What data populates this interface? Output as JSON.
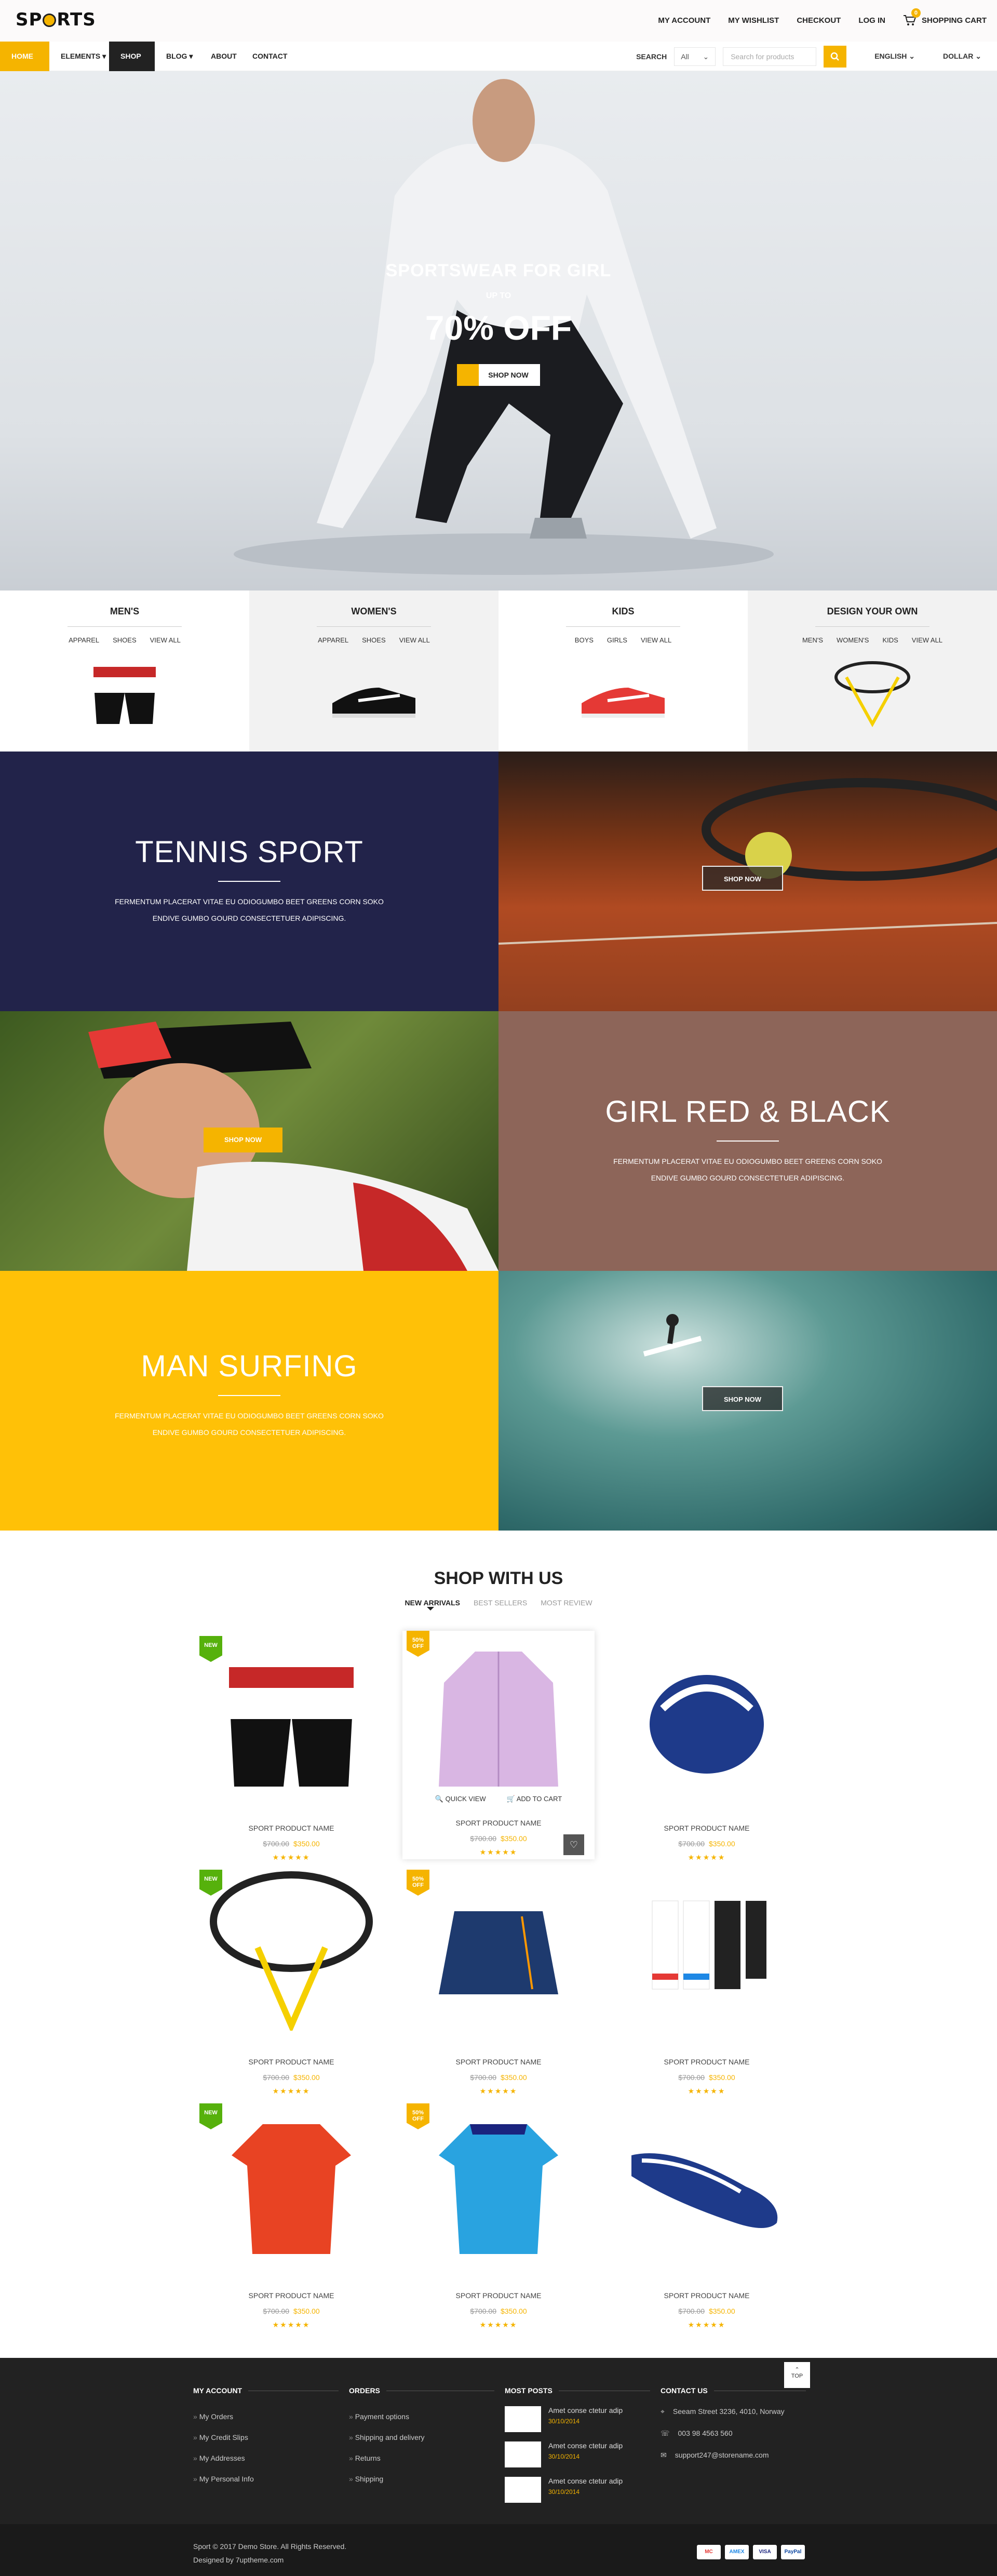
{
  "header": {
    "logo": "SPORTS",
    "links": [
      "MY ACCOUNT",
      "MY WISHLIST",
      "CHECKOUT",
      "LOG IN"
    ],
    "cart_count": "0",
    "cart_label": "SHOPPING CART"
  },
  "nav": {
    "items": [
      "HOME",
      "ELEMENTS",
      "SHOP",
      "BLOG",
      "ABOUT",
      "CONTACT"
    ],
    "search_label": "SEARCH",
    "category_value": "All",
    "search_placeholder": "Search for products",
    "language": "ENGLISH",
    "currency": "DOLLAR"
  },
  "hero": {
    "title": "SPORTSWEAR FOR GIRL",
    "upto": "UP TO",
    "offer": "70% OFF",
    "button": "SHOP NOW"
  },
  "categories": [
    {
      "title": "MEN'S",
      "subs": [
        "APPAREL",
        "SHOES",
        "VIEW ALL"
      ]
    },
    {
      "title": "WOMEN'S",
      "subs": [
        "APPAREL",
        "SHOES",
        "VIEW ALL"
      ]
    },
    {
      "title": "KIDS",
      "subs": [
        "BOYS",
        "GIRLS",
        "VIEW ALL"
      ]
    },
    {
      "title": "DESIGN YOUR OWN",
      "subs": [
        "MEN'S",
        "WOMEN'S",
        "KIDS",
        "VIEW ALL"
      ]
    }
  ],
  "banners": {
    "tennis": {
      "title": "TENNIS SPORT",
      "text": "FERMENTUM PLACERAT VITAE EU ODIOGUMBO BEET GREENS CORN SOKO ENDIVE GUMBO GOURD CONSECTETUER ADIPISCING.",
      "button": "SHOP NOW"
    },
    "girl": {
      "title": "GIRL RED & BLACK",
      "text": "FERMENTUM PLACERAT VITAE EU ODIOGUMBO BEET GREENS CORN SOKO ENDIVE GUMBO GOURD CONSECTETUER ADIPISCING.",
      "button": "SHOP NOW"
    },
    "surf": {
      "title": "MAN SURFING",
      "text": "FERMENTUM PLACERAT VITAE EU ODIOGUMBO BEET GREENS CORN SOKO ENDIVE GUMBO GOURD CONSECTETUER ADIPISCING.",
      "button": "SHOP NOW"
    }
  },
  "shop": {
    "title": "SHOP WITH US",
    "tabs": [
      "NEW ARRIVALS",
      "BEST SELLERS",
      "MOST REVIEW"
    ],
    "quick_view": "QUICK VIEW",
    "add_to_cart": "ADD TO CART",
    "products": [
      {
        "tag": "NEW",
        "name": "SPORT PRODUCT NAME",
        "old": "$700.00",
        "price": "$350.00",
        "stars": "★★★★★"
      },
      {
        "tag": "50% OFF",
        "name": "SPORT PRODUCT NAME",
        "old": "$700.00",
        "price": "$350.00",
        "stars": "★★★★★"
      },
      {
        "tag": "",
        "name": "SPORT PRODUCT NAME",
        "old": "$700.00",
        "price": "$350.00",
        "stars": "★★★★★"
      },
      {
        "tag": "NEW",
        "name": "SPORT PRODUCT NAME",
        "old": "$700.00",
        "price": "$350.00",
        "stars": "★★★★★"
      },
      {
        "tag": "50% OFF",
        "name": "SPORT PRODUCT NAME",
        "old": "$700.00",
        "price": "$350.00",
        "stars": "★★★★★"
      },
      {
        "tag": "",
        "name": "SPORT PRODUCT NAME",
        "old": "$700.00",
        "price": "$350.00",
        "stars": "★★★★★"
      },
      {
        "tag": "NEW",
        "name": "SPORT PRODUCT NAME",
        "old": "$700.00",
        "price": "$350.00",
        "stars": "★★★★★"
      },
      {
        "tag": "50% OFF",
        "name": "SPORT PRODUCT NAME",
        "old": "$700.00",
        "price": "$350.00",
        "stars": "★★★★★"
      },
      {
        "tag": "",
        "name": "SPORT PRODUCT NAME",
        "old": "$700.00",
        "price": "$350.00",
        "stars": "★★★★★"
      }
    ]
  },
  "footer": {
    "account": {
      "title": "MY ACCOUNT",
      "items": [
        "My Orders",
        "My Credit Slips",
        "My Addresses",
        "My Personal Info"
      ]
    },
    "orders": {
      "title": "ORDERS",
      "items": [
        "Payment options",
        "Shipping and delivery",
        "Returns",
        "Shipping"
      ]
    },
    "posts": {
      "title": "MOST POSTS",
      "items": [
        {
          "title": "Amet conse ctetur adip",
          "date": "30/10/2014"
        },
        {
          "title": "Amet conse ctetur adip",
          "date": "30/10/2014"
        },
        {
          "title": "Amet conse ctetur adip",
          "date": "30/10/2014"
        }
      ]
    },
    "contact": {
      "title": "CONTACT US",
      "address": "Seeam Street 3236, 4010, Norway",
      "phone": "003 98 4563 560",
      "email": "support247@storename.com"
    },
    "top": "TOP",
    "copyright": "Sport © 2017 Demo Store. All Rights Reserved.",
    "designed": "Designed by 7uptheme.com",
    "payments": [
      "MC",
      "AMEX",
      "VISA",
      "PayPal"
    ]
  },
  "colors": {
    "accent": "#f5b400",
    "dark": "#222222",
    "tennis_bg": "#22234a",
    "girl_bg": "#8d6559",
    "surf_bg": "#ffc107"
  }
}
